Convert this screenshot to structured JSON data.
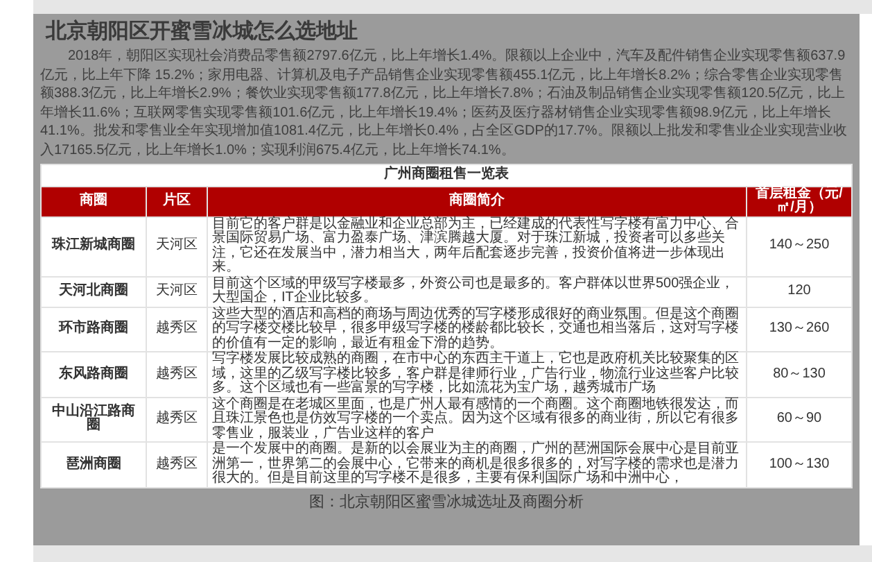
{
  "document": {
    "title": "北京朝阳区开蜜雪冰城怎么选地址",
    "paragraph": "2018年，朝阳区实现社会消费品零售额2797.6亿元，比上年增长1.4%。限额以上企业中，汽车及配件销售企业实现零售额637.9亿元，比上年下降 15.2%；家用电器、计算机及电子产品销售企业实现零售额455.1亿元，比上年增长8.2%；综合零售企业实现零售额388.3亿元，比上年增长2.9%；餐饮业实现零售额177.8亿元，比上年增长7.8%；石油及制品销售企业实现零售额120.5亿元，比上年增长11.6%；互联网零售实现零售额101.6亿元，比上年增长19.4%；医药及医疗器材销售企业实现零售额98.9亿元，比上年增长41.1%。批发和零售业全年实现增加值1081.4亿元，比上年增长0.4%，占全区GDP的17.7%。限额以上批发和零售业企业实现营业收入17165.5亿元，比上年增长1.0%；实现利润675.4亿元，比上年增长74.1%。",
    "table": {
      "title": "广州商圈租售一览表",
      "columns": [
        "商圈",
        "片区",
        "商圈简介",
        "首层租金（元/㎡/月）"
      ],
      "rows": [
        {
          "name": "珠江新城商圈",
          "district": "天河区",
          "intro": "目前它的客户群是以金融业和企业总部为主，已经建成的代表性写字楼有富力中心、合景国际贸易广场、富力盈泰广场、津滨腾越大厦。对于珠江新城，投资者可以多些关注，它还在发展当中，潜力相当大，两年后配套逐步完善，投资价值将进一步体现出来。",
          "rent": "140～250"
        },
        {
          "name": "天河北商圈",
          "district": "天河区",
          "intro": "目前这个区域的甲级写字楼最多，外资公司也是最多的。客户群体以世界500强企业，大型国企，IT企业比较多。",
          "rent": "120"
        },
        {
          "name": "环市路商圈",
          "district": "越秀区",
          "intro": "这些大型的酒店和高档的商场与周边优秀的写字楼形成很好的商业氛围。但是这个商圈的写字楼交楼比较早，很多甲级写字楼的楼龄都比较长，交通也相当落后，这对写字楼的价值有一定的影响，最近有租金下滑的趋势。",
          "rent": "130～260"
        },
        {
          "name": "东风路商圈",
          "district": "越秀区",
          "intro": "写字楼发展比较成熟的商圈，在市中心的东西主干道上，它也是政府机关比较聚集的区域，这里的乙级写字楼比较多，客户群是律师行业，广告行业，物流行业这些客户比较多。这个区域也有一些富景的写字楼，比如流花为宝广场，越秀城市广场",
          "rent": "80～130"
        },
        {
          "name": "中山沿江路商圈",
          "district": "越秀区",
          "intro": "这个商圈是在老城区里面，也是广州人最有感情的一个商圈。这个商圈地铁很发达，而且珠江景色也是仿效写字楼的一个卖点。因为这个区域有很多的商业街，所以它有很多零售业，服装业，广告业这样的客户",
          "rent": "60～90"
        },
        {
          "name": "琶洲商圈",
          "district": "越秀区",
          "intro": "是一个发展中的商圈。是新的以会展业为主的商圈，广州的琶洲国际会展中心是目前亚洲第一，世界第二的会展中心，它带来的商机是很多很多的，对写字楼的需求也是潜力很大的。但是目前这里的写字楼不是很多，主要有保利国际广场和中洲中心，",
          "rent": "100～130"
        }
      ]
    },
    "caption": "图：北京朝阳区蜜雪冰城选址及商圈分析"
  }
}
